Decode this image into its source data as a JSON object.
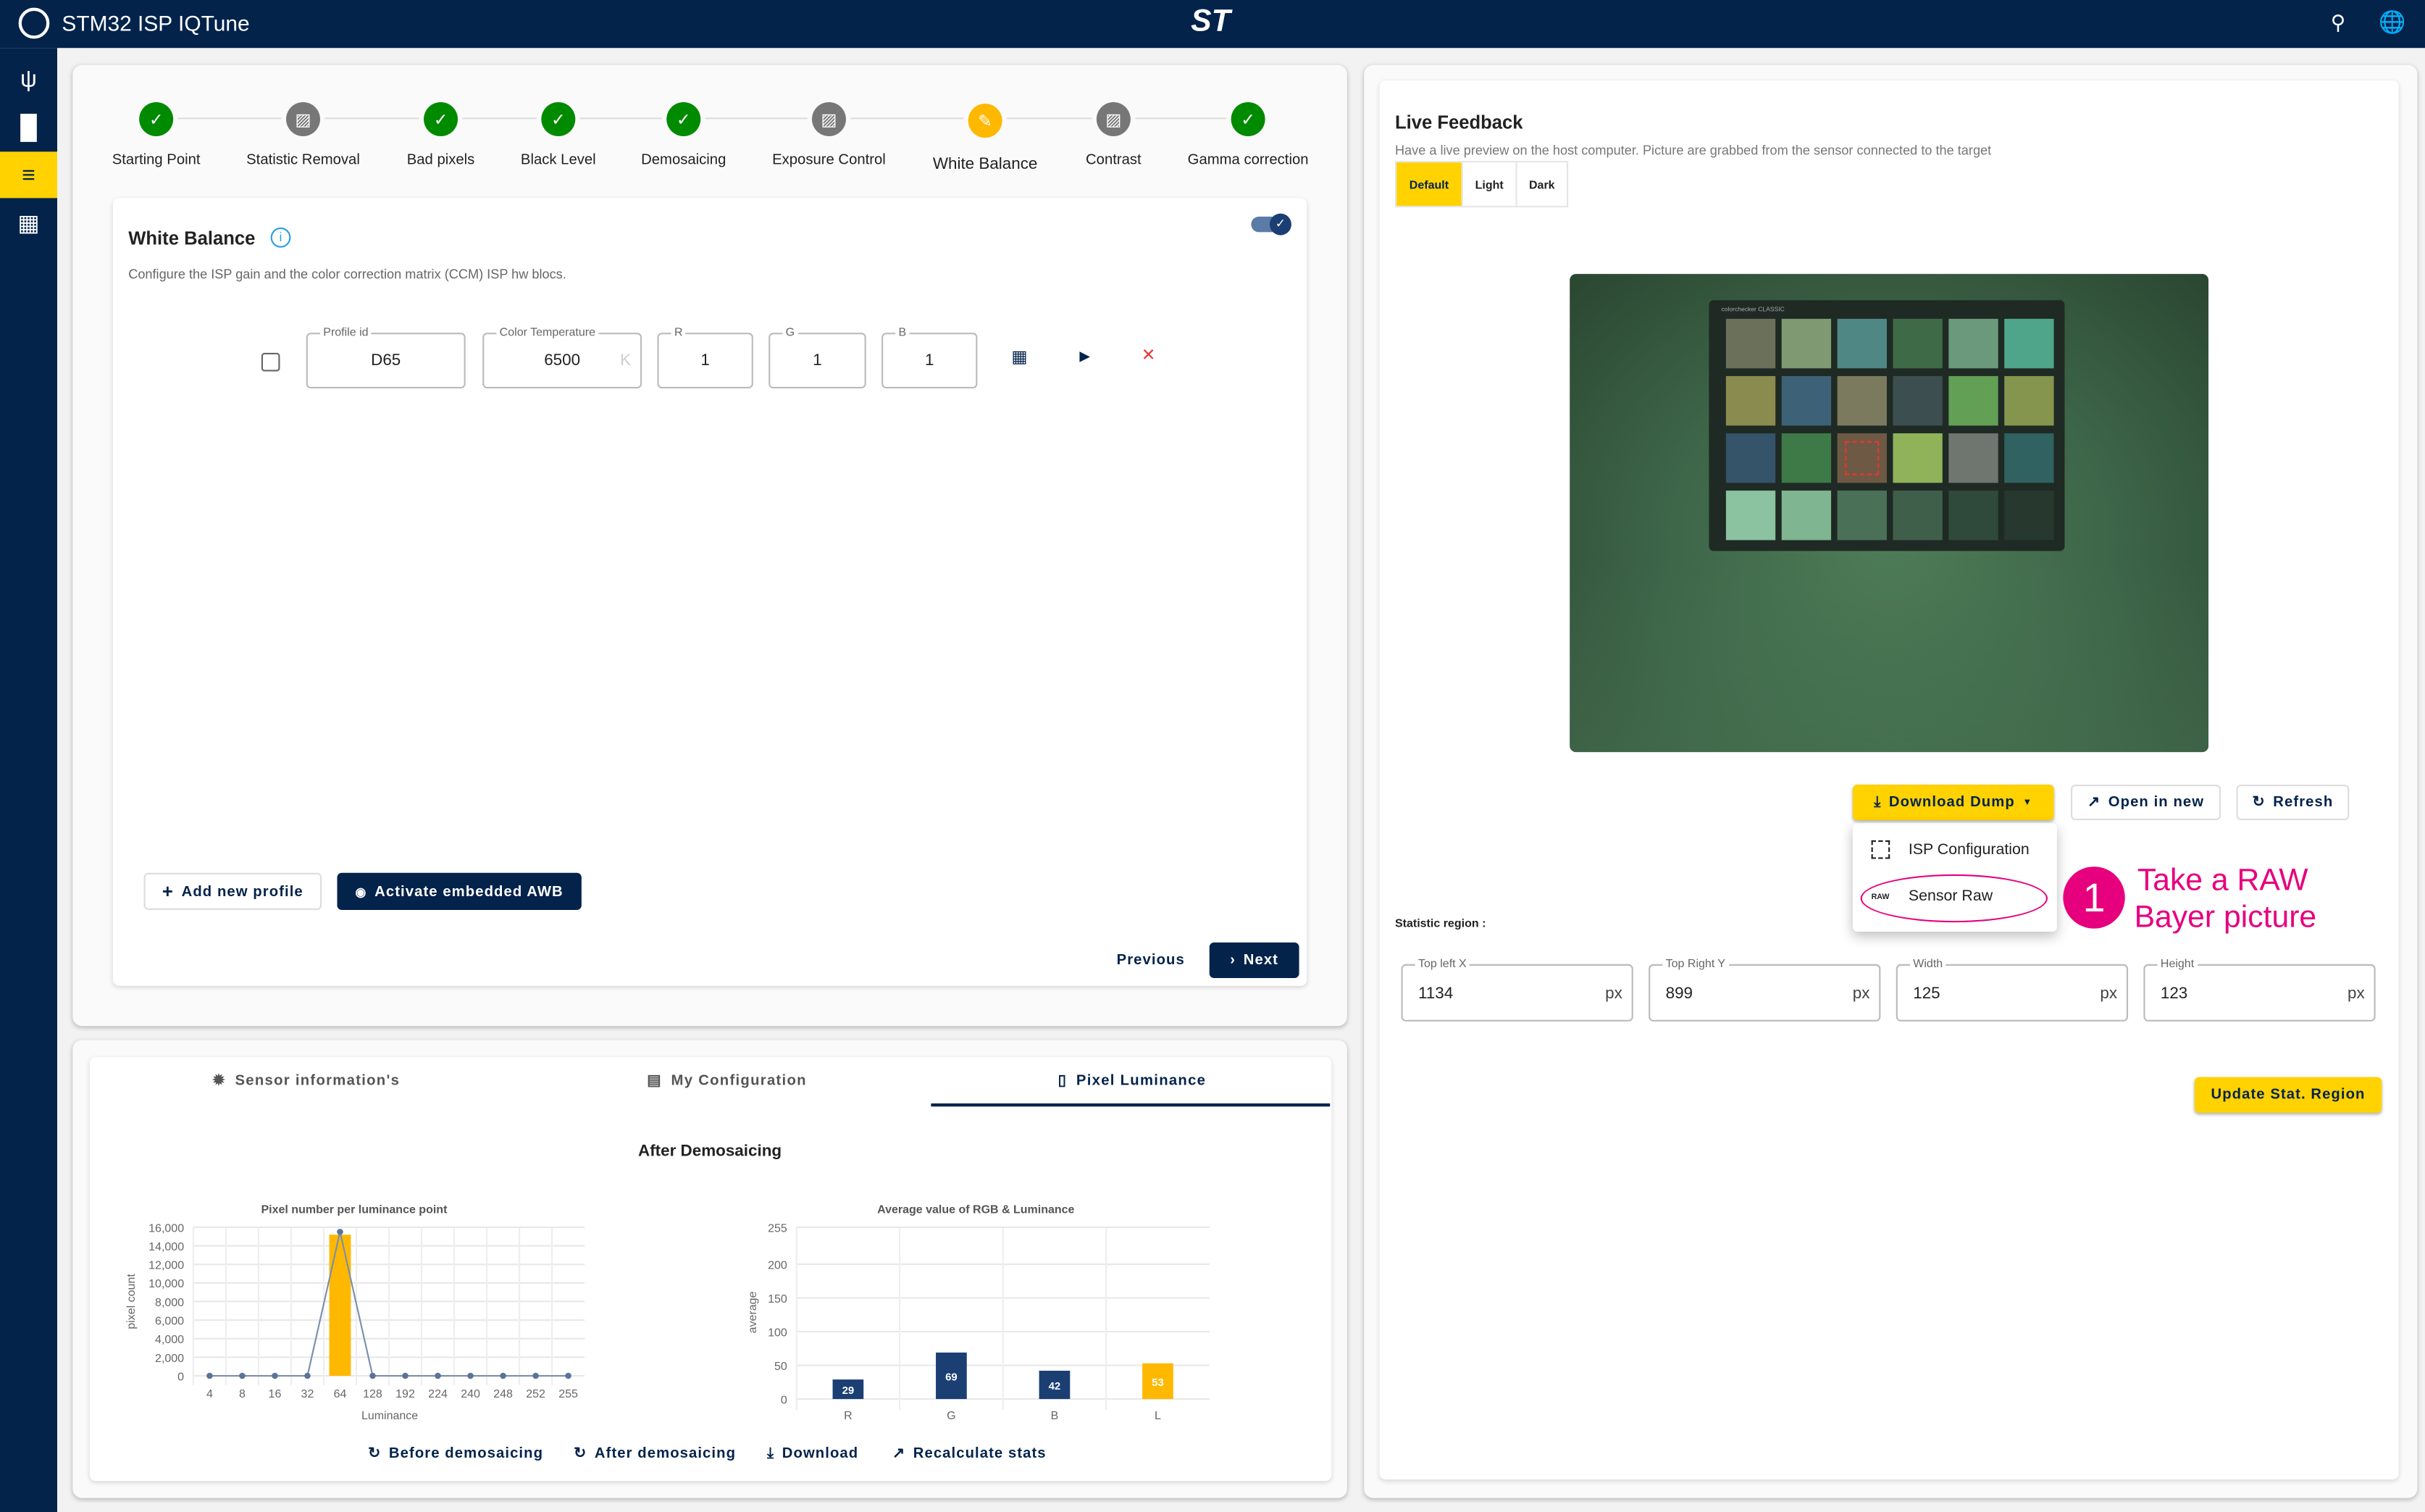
{
  "app": {
    "title": "STM32 ISP IQTune",
    "logo": "ST"
  },
  "header": {
    "icons": [
      "search-icon",
      "globe-icon"
    ]
  },
  "sidebar": {
    "items": [
      {
        "icon": "usb-icon"
      },
      {
        "icon": "waveform-icon"
      },
      {
        "icon": "tune-icon",
        "active": true
      },
      {
        "icon": "document-icon"
      }
    ]
  },
  "stepper": {
    "steps": [
      {
        "label": "Starting Point",
        "state": "done"
      },
      {
        "label": "Statistic Removal",
        "state": "disabled"
      },
      {
        "label": "Bad pixels",
        "state": "done"
      },
      {
        "label": "Black Level",
        "state": "done"
      },
      {
        "label": "Demosaicing",
        "state": "done"
      },
      {
        "label": "Exposure Control",
        "state": "disabled"
      },
      {
        "label": "White Balance",
        "state": "active"
      },
      {
        "label": "Contrast",
        "state": "disabled"
      },
      {
        "label": "Gamma correction",
        "state": "done"
      }
    ]
  },
  "wb": {
    "title": "White Balance",
    "description": "Configure the ISP gain and the color correction matrix (CCM) ISP hw blocs.",
    "enabled": true,
    "profile": {
      "profile_id_label": "Profile id",
      "profile_id": "D65",
      "temp_label": "Color Temperature",
      "temp": "6500",
      "temp_unit": "K",
      "r_label": "R",
      "r": "1",
      "g_label": "G",
      "g": "1",
      "b_label": "B",
      "b": "1"
    },
    "add_profile": "Add new profile",
    "activate_awb": "Activate embedded AWB",
    "previous": "Previous",
    "next": "Next"
  },
  "bottom": {
    "tabs": [
      {
        "label": "Sensor information's"
      },
      {
        "label": "My Configuration"
      },
      {
        "label": "Pixel Luminance",
        "active": true
      }
    ],
    "heading": "After Demosaicing",
    "actions": [
      "Before demosaicing",
      "After demosaicing",
      "Download",
      "Recalculate stats"
    ]
  },
  "chart_data": [
    {
      "type": "bar+line",
      "title": "Pixel number per luminance point",
      "xlabel": "Luminance",
      "ylabel": "pixel count",
      "ylim": [
        0,
        16000
      ],
      "yticks": [
        "0",
        "2,000",
        "4,000",
        "6,000",
        "8,000",
        "10,000",
        "12,000",
        "14,000",
        "16,000"
      ],
      "categories": [
        "4",
        "8",
        "16",
        "32",
        "64",
        "128",
        "192",
        "224",
        "240",
        "248",
        "252",
        "255"
      ],
      "bar_values": [
        0,
        0,
        0,
        0,
        15200,
        0,
        0,
        0,
        0,
        0,
        0,
        0
      ],
      "line_values": [
        0,
        0,
        0,
        0,
        15500,
        0,
        0,
        0,
        0,
        0,
        0,
        0
      ],
      "bar_color": "#ffb800",
      "line_color": "#7b8fad",
      "grid": true
    },
    {
      "type": "bar",
      "title": "Average value of RGB & Luminance",
      "ylabel": "average",
      "ylim": [
        0,
        255
      ],
      "yticks": [
        "0",
        "50",
        "100",
        "150",
        "200",
        "255"
      ],
      "categories": [
        "R",
        "G",
        "B",
        "L"
      ],
      "values": [
        29,
        69,
        42,
        53
      ],
      "colors": [
        "#1b3f73",
        "#1b3f73",
        "#1b3f73",
        "#ffb800"
      ],
      "grid": true
    }
  ],
  "live": {
    "title": "Live Feedback",
    "description": "Have a live preview on the host computer. Picture are grabbed from the sensor connected to the target",
    "themes": [
      {
        "label": "Default",
        "active": true
      },
      {
        "label": "Light"
      },
      {
        "label": "Dark"
      }
    ],
    "download_dump": "Download Dump",
    "open_new": "Open in new",
    "refresh": "Refresh",
    "menu": [
      {
        "label": "ISP Configuration",
        "icon": "image-frame-icon"
      },
      {
        "label": "Sensor Raw",
        "icon": "raw-icon",
        "icon_text": "RAW"
      }
    ],
    "chart_brand": "colorchecker CLASSIC",
    "stat_label": "Statistic region :",
    "fields": [
      {
        "label": "Top left X",
        "value": "1134",
        "unit": "px"
      },
      {
        "label": "Top Right Y",
        "value": "899",
        "unit": "px"
      },
      {
        "label": "Width",
        "value": "125",
        "unit": "px"
      },
      {
        "label": "Height",
        "value": "123",
        "unit": "px"
      }
    ],
    "update": "Update Stat. Region"
  },
  "annotation": {
    "number": "1",
    "line1": "Take a RAW",
    "line2": "Bayer picture",
    "color": "#e6007e"
  }
}
